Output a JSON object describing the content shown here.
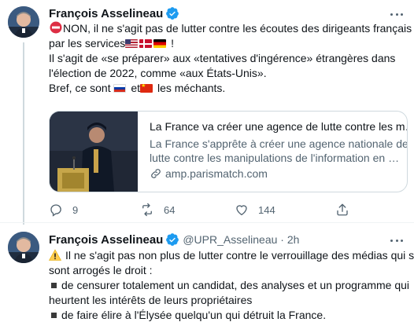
{
  "tweets": [
    {
      "author": "François Asselineau",
      "verified": true,
      "lines": [
        "NON, il ne s'agit pas de lutter contre les écoutes des dirigeants français",
        "par les services",
        " !",
        "Il s'agit de «se préparer» aux  «tentatives d'ingérence» étrangères dans",
        "l'élection de 2022, comme «aux États-Unis».",
        "Bref, ce sont ",
        " et",
        " les méchants."
      ],
      "emoji": {
        "no_entry": "no-entry-icon",
        "flags_line2": [
          "flag-us",
          "flag-dk",
          "flag-de"
        ],
        "flag_russia": "flag-ru",
        "flag_china": "flag-cn"
      },
      "card": {
        "title": "La France va créer une agence de lutte contre les m…",
        "desc_line1": "La France s'apprête à créer une agence nationale de",
        "desc_line2": "lutte contre les manipulations de l'information en …",
        "domain": "amp.parismatch.com"
      },
      "actions": {
        "replies": "9",
        "retweets": "64",
        "likes": "144"
      }
    },
    {
      "author": "François Asselineau",
      "verified": true,
      "handle": "@UPR_Asselineau · 2h",
      "lines": [
        "Il ne s'agit pas non plus de lutter contre le verrouillage des médias qui se",
        "sont arrogés le droit :",
        "de censurer totalement un candidat, des analyses et un programme qui",
        "heurtent les intérêts de leurs propriétaires",
        "de faire élire à l'Élysée quelqu'un qui détruit la France."
      ],
      "emoji": {
        "warning": "warning-icon"
      }
    }
  ],
  "colors": {
    "text": "#0f1419",
    "secondary": "#536471",
    "verified": "#1d9bf0",
    "border": "#cfd9de"
  }
}
